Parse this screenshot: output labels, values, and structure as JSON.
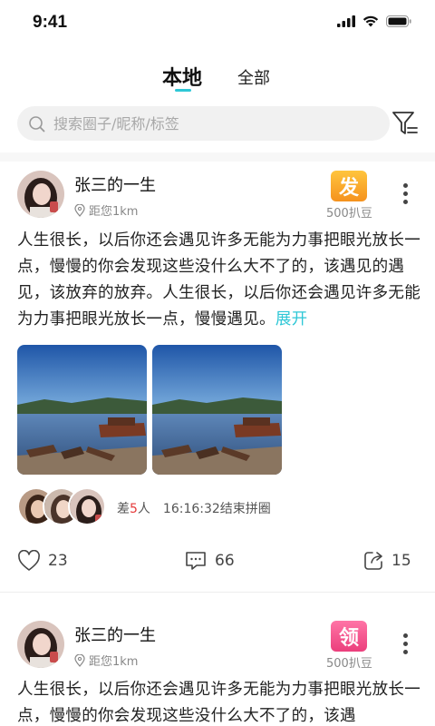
{
  "status": {
    "time": "9:41"
  },
  "tabs": [
    {
      "label": "本地"
    },
    {
      "label": "全部"
    }
  ],
  "search": {
    "placeholder": "搜索圈子/昵称/标签"
  },
  "posts": [
    {
      "username": "张三的一生",
      "distance": "距您1km",
      "badge": {
        "label": "发",
        "sub": "500扒豆",
        "color": "#f7a21b"
      },
      "text": "人生很长，以后你还会遇见许多无能为力事把眼光放长一点，慢慢的你会发现这些没什么大不了的，该遇见的遇见，该放弃的放弃。人生很长，以后你还会遇见许多无能为力事把眼光放长一点，慢慢遇见。",
      "expand": "展开",
      "group": {
        "prefix": "差",
        "count": "5",
        "suffix": "人",
        "time": "16:16:32结束拼圈"
      },
      "likes": "23",
      "comments": "66",
      "shares": "15"
    },
    {
      "username": "张三的一生",
      "distance": "距您1km",
      "badge": {
        "label": "领",
        "sub": "500扒豆",
        "color": "#f0508a"
      },
      "text": "人生很长，以后你还会遇见许多无能为力事把眼光放长一点，慢慢的你会发现这些没什么大不了的，该遇"
    }
  ]
}
